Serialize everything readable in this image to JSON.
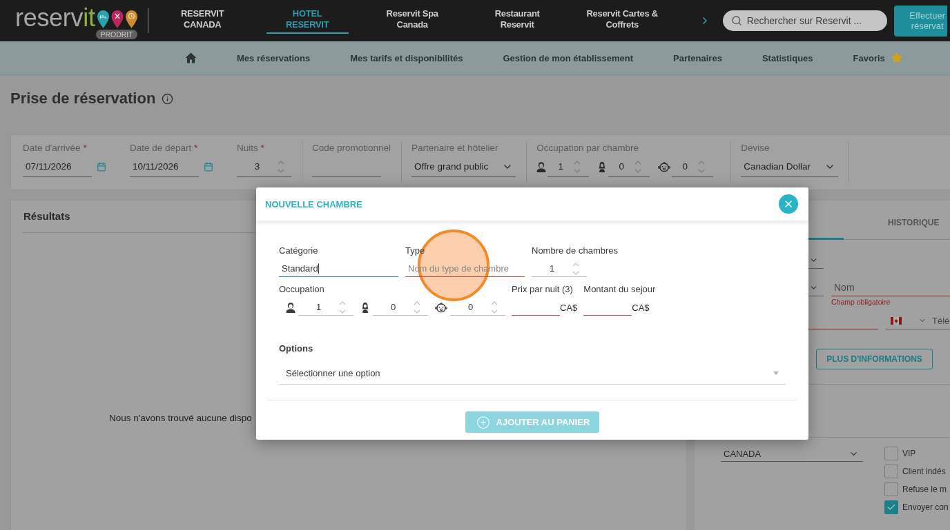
{
  "header": {
    "logo": {
      "wordmark": "reserv",
      "wordmark_accent": "it",
      "badge": "PRODRIT"
    },
    "products": [
      {
        "label": "RESERVIT CANADA",
        "selected": false
      },
      {
        "label": "HOTEL RESERVIT",
        "selected": true
      },
      {
        "label": "Reservit Spa Canada",
        "selected": false
      },
      {
        "label": "Restaurant Reservit",
        "selected": false
      },
      {
        "label": "Reservit Cartes & Coffrets",
        "selected": false
      }
    ],
    "search": {
      "placeholder": "Rechercher sur Reservit ..."
    },
    "action_button": "Effectuer réservat"
  },
  "main_nav": [
    {
      "kind": "home"
    },
    {
      "kind": "link",
      "label": "Mes réservations"
    },
    {
      "kind": "link",
      "label": "Mes tarifs et disponibilités"
    },
    {
      "kind": "link",
      "label": "Gestion de mon établissement"
    },
    {
      "kind": "link",
      "label": "Partenaires"
    },
    {
      "kind": "link",
      "label": "Statistiques"
    },
    {
      "kind": "favorites",
      "label": "Favoris"
    }
  ],
  "page_title": "Prise de réservation",
  "search_form": {
    "fields": [
      {
        "kind": "date",
        "label": "Date d'arrivée",
        "required_mark": "*",
        "value": "07/11/2026"
      },
      {
        "kind": "date",
        "label": "Date de départ",
        "required_mark": "*",
        "value": "10/11/2026"
      },
      {
        "kind": "number",
        "label": "Nuits",
        "required_mark": "*",
        "value": "3"
      },
      {
        "kind": "text",
        "label": "Code promotionnel"
      },
      {
        "kind": "select",
        "label": "Partenaire et hôtelier",
        "value": "Offre grand public"
      },
      {
        "kind": "occupancy",
        "label": "Occupation par chambre",
        "guests": [
          {
            "kind": "man",
            "value": "1"
          },
          {
            "kind": "woman",
            "value": "0"
          },
          {
            "kind": "baby",
            "value": "0"
          }
        ]
      },
      {
        "kind": "select",
        "label": "Devise",
        "value": "Canadian Dollar"
      }
    ]
  },
  "results": {
    "title": "Résultats",
    "message": "Nous n'avons trouvé aucune dispo"
  },
  "customer_panel": {
    "tabs": [
      {
        "selected": true
      },
      {
        "label": "HISTORIQUE",
        "selected": false
      }
    ],
    "rows": [
      {
        "fields": [
          {
            "kind": "select",
            "invalid": false
          }
        ]
      },
      {
        "fields": [
          {
            "kind": "select",
            "invalid": false
          },
          {
            "kind": "text",
            "placeholder": "Nom",
            "invalid": true,
            "error": "Champ obligatoire"
          }
        ]
      },
      {
        "fields": [
          {
            "kind": "text",
            "invalid": true
          },
          {
            "kind": "phone",
            "placeholder": "Télé",
            "invalid": false
          }
        ]
      }
    ],
    "more_button": "PLUS D'INFORMATIONS",
    "country": "CANADA",
    "checkboxes": [
      {
        "label": "VIP",
        "checked": false
      },
      {
        "label": "Client indés",
        "checked": false
      },
      {
        "label": "Refuse le m",
        "checked": false
      },
      {
        "label": "Envoyer con",
        "checked": true
      }
    ]
  },
  "modal": {
    "title": "NOUVELLE CHAMBRE",
    "fields": [
      {
        "kind": "text",
        "label": "Catégorie",
        "value": "Standard",
        "focused": true,
        "invalid": false
      },
      {
        "kind": "text",
        "label": "Type",
        "placeholder": "Nom du type de chambre",
        "focused": false,
        "invalid": true
      },
      {
        "kind": "number",
        "label": "Nombre de chambres",
        "value": "1",
        "focused": false,
        "invalid": false
      }
    ],
    "occupation": {
      "label": "Occupation",
      "guests": [
        {
          "kind": "man",
          "value": "1"
        },
        {
          "kind": "woman",
          "value": "0"
        },
        {
          "kind": "baby",
          "value": "0"
        }
      ]
    },
    "amounts": [
      {
        "label": "Prix par nuit (3)",
        "currency": "CA$",
        "invalid": true
      },
      {
        "label": "Montant du sejour",
        "currency": "CA$",
        "invalid": true
      }
    ],
    "options": {
      "label": "Options",
      "placeholder": "Sélectionner une option"
    },
    "submit": {
      "label": "AJOUTER AU PANIER",
      "disabled": true
    }
  }
}
